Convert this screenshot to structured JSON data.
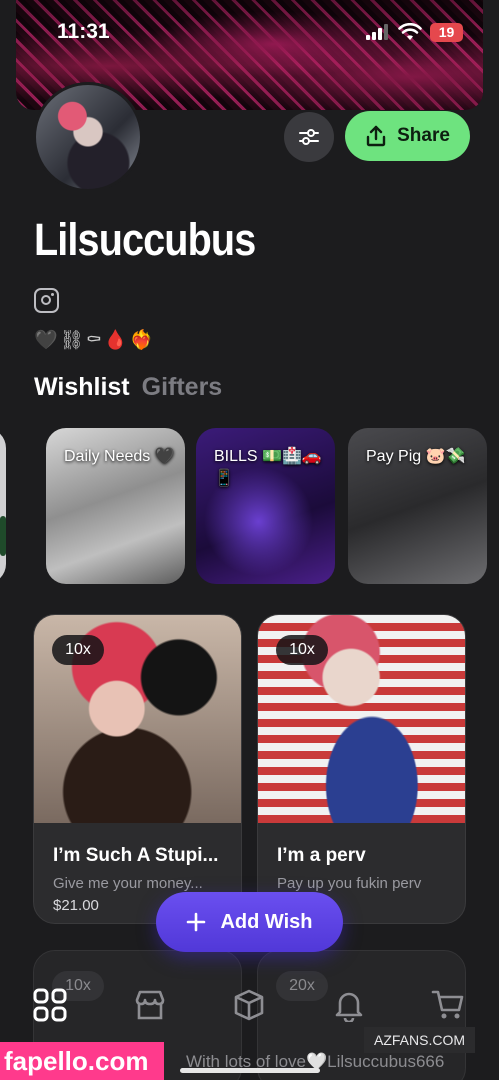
{
  "status_bar": {
    "time": "11:31",
    "battery": "19"
  },
  "profile": {
    "name": "Lilsuccubus",
    "emojis": "🖤⛓⚰🩸❤️‍🔥",
    "share_label": "Share"
  },
  "tabs": [
    {
      "label": "Wishlist",
      "active": true
    },
    {
      "label": "Gifters",
      "active": false
    }
  ],
  "categories": [
    {
      "label": "Daily Needs 🖤"
    },
    {
      "label": "BILLS 💵🏥🚗📱"
    },
    {
      "label": "Pay Pig 🐷💸"
    }
  ],
  "wishes": [
    {
      "badge": "10x",
      "title": "I’m Such A Stupi...",
      "subtitle": "Give me your money...",
      "price": "$21.00"
    },
    {
      "badge": "10x",
      "title": "I’m a perv",
      "subtitle": "Pay up you fukin perv",
      "price": ""
    }
  ],
  "wishes_partial": [
    {
      "badge": "10x"
    },
    {
      "badge": "20x"
    }
  ],
  "add_wish_label": "Add Wish",
  "watermarks": {
    "site_right": "AZFANS.COM",
    "site_left": "fapello.com",
    "footer": "With lots of love🤍Lilsuccubus666"
  },
  "colors": {
    "share_green": "#6ee37f",
    "add_wish_purple": "#5b44e6",
    "background": "#1c1c1e"
  }
}
